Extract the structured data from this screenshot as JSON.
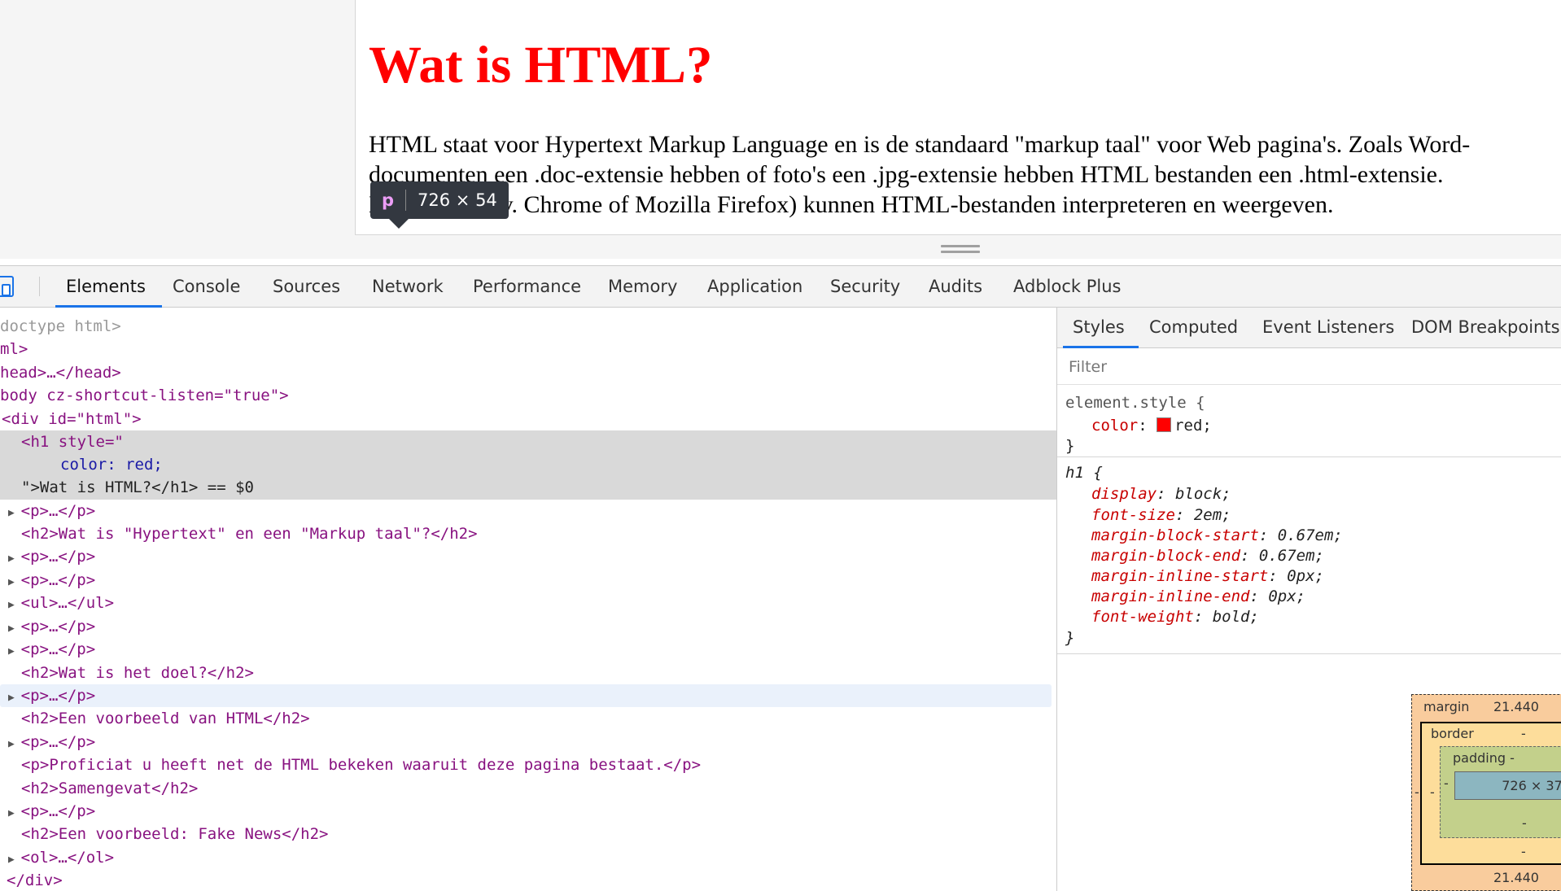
{
  "page": {
    "heading": "Wat is HTML?",
    "heading_color": "#ff0000",
    "paragraph_lines": [
      "HTML staat voor Hypertext Markup Language en is de standaard \"markup taal\" voor Web pagina's. Zoals Word-",
      "documenten een .doc-extensie hebben of foto's een .jpg-extensie hebben HTML bestanden een .html-extensie.",
      "Browsers (bijv. Chrome of Mozilla Firefox) kunnen HTML-bestanden interpreteren en weergeven."
    ],
    "tooltip": {
      "tag": "p",
      "size": "726 × 54"
    }
  },
  "devtools": {
    "tabs": [
      "Elements",
      "Console",
      "Sources",
      "Network",
      "Performance",
      "Memory",
      "Application",
      "Security",
      "Audits",
      "Adblock Plus"
    ],
    "active_tab": "Elements",
    "tree": [
      {
        "text": "doctype html>"
      },
      {
        "text": "ml>"
      },
      {
        "text": "head>…</head>"
      },
      {
        "text": "body cz-shortcut-listen=\"true\">"
      },
      {
        "text": "<div id=\"html\">"
      },
      {
        "text": "<h1 style=\""
      },
      {
        "text": "color: red;"
      },
      {
        "text": "\">Wat is HTML?</h1> == $0"
      },
      {
        "text": "<p>…</p>"
      },
      {
        "text": "<h2>Wat is \"Hypertext\" en een \"Markup taal\"?</h2>"
      },
      {
        "text": "<p>…</p>"
      },
      {
        "text": "<p>…</p>"
      },
      {
        "text": "<ul>…</ul>"
      },
      {
        "text": "<p>…</p>"
      },
      {
        "text": "<p>…</p>"
      },
      {
        "text": "<h2>Wat is het doel?</h2>"
      },
      {
        "text": "<p>…</p>"
      },
      {
        "text": "<h2>Een voorbeeld van HTML</h2>"
      },
      {
        "text": "<p>…</p>"
      },
      {
        "text": "<p>Proficiat u heeft net de HTML bekeken waaruit deze pagina bestaat.</p>"
      },
      {
        "text": "<h2>Samengevat</h2>"
      },
      {
        "text": "<p>…</p>"
      },
      {
        "text": "<h2>Een voorbeeld: Fake News</h2>"
      },
      {
        "text": "<ol>…</ol>"
      },
      {
        "text": "</div>"
      }
    ],
    "styles_pane": {
      "tabs": [
        "Styles",
        "Computed",
        "Event Listeners",
        "DOM Breakpoints"
      ],
      "active_tab": "Styles",
      "filter_placeholder": "Filter",
      "element_style": {
        "selector": "element.style {",
        "prop": "color",
        "value": "red;",
        "close": "}"
      },
      "h1_rule": {
        "selector": "h1 {",
        "props": [
          {
            "name": "display",
            "value": "block;"
          },
          {
            "name": "font-size",
            "value": "2em;"
          },
          {
            "name": "margin-block-start",
            "value": "0.67em;"
          },
          {
            "name": "margin-block-end",
            "value": "0.67em;"
          },
          {
            "name": "margin-inline-start",
            "value": "0px;"
          },
          {
            "name": "margin-inline-end",
            "value": "0px;"
          },
          {
            "name": "font-weight",
            "value": "bold;"
          }
        ],
        "close": "}"
      },
      "box_model": {
        "margin_label": "margin",
        "margin_top": "21.440",
        "margin_bottom": "21.440",
        "margin_left": "-",
        "border_label": "border",
        "border_top": "-",
        "border_bottom": "-",
        "border_left": "-",
        "padding_label": "padding -",
        "padding_bottom": "-",
        "padding_left": "-",
        "content": "726 × 37"
      }
    }
  }
}
